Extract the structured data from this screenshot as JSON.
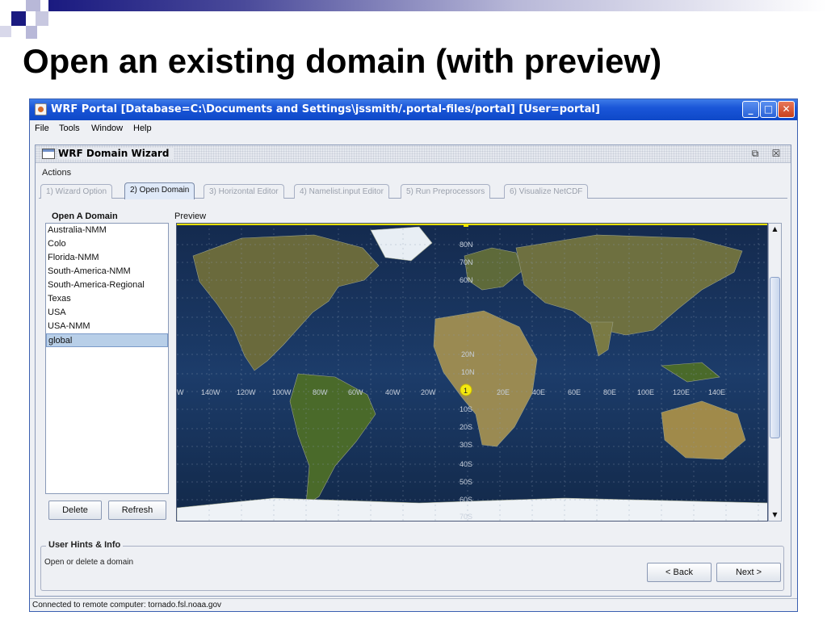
{
  "slide": {
    "title": "Open an existing domain (with preview)"
  },
  "window": {
    "title": "WRF Portal  [Database=C:\\Documents and Settings\\jssmith/.portal-files/portal]  [User=portal]",
    "menu": [
      "File",
      "Tools",
      "Window",
      "Help"
    ]
  },
  "wizard": {
    "title": "WRF Domain Wizard",
    "actions_label": "Actions",
    "tabs": [
      {
        "label": "1) Wizard Option",
        "active": false
      },
      {
        "label": "2) Open Domain",
        "active": true
      },
      {
        "label": "3) Horizontal Editor",
        "active": false
      },
      {
        "label": "4) Namelist.input Editor",
        "active": false
      },
      {
        "label": "5) Run Preprocessors",
        "active": false
      },
      {
        "label": "6) Visualize NetCDF",
        "active": false
      }
    ],
    "open_domain": {
      "heading": "Open A Domain",
      "domains": [
        "Australia-NMM",
        "Colo",
        "Florida-NMM",
        "South-America-NMM",
        "South-America-Regional",
        "Texas",
        "USA",
        "USA-NMM",
        "global"
      ],
      "selected": "global",
      "delete_label": "Delete",
      "refresh_label": "Refresh"
    },
    "preview": {
      "heading": "Preview",
      "lat_labels": [
        "80N",
        "70N",
        "60N",
        "20N",
        "10N",
        "10S",
        "20S",
        "30S",
        "40S",
        "50S",
        "60S",
        "70S"
      ],
      "lon_labels": [
        "W",
        "140W",
        "120W",
        "100W",
        "80W",
        "60W",
        "40W",
        "20W",
        "20E",
        "40E",
        "60E",
        "80E",
        "100E",
        "120E",
        "140E"
      ],
      "marker": "1"
    },
    "hints": {
      "title": "User Hints & Info",
      "text": "Open or delete a domain"
    },
    "back_label": "< Back",
    "next_label": "Next >"
  },
  "status": "Connected to remote computer: tornado.fsl.noaa.gov"
}
